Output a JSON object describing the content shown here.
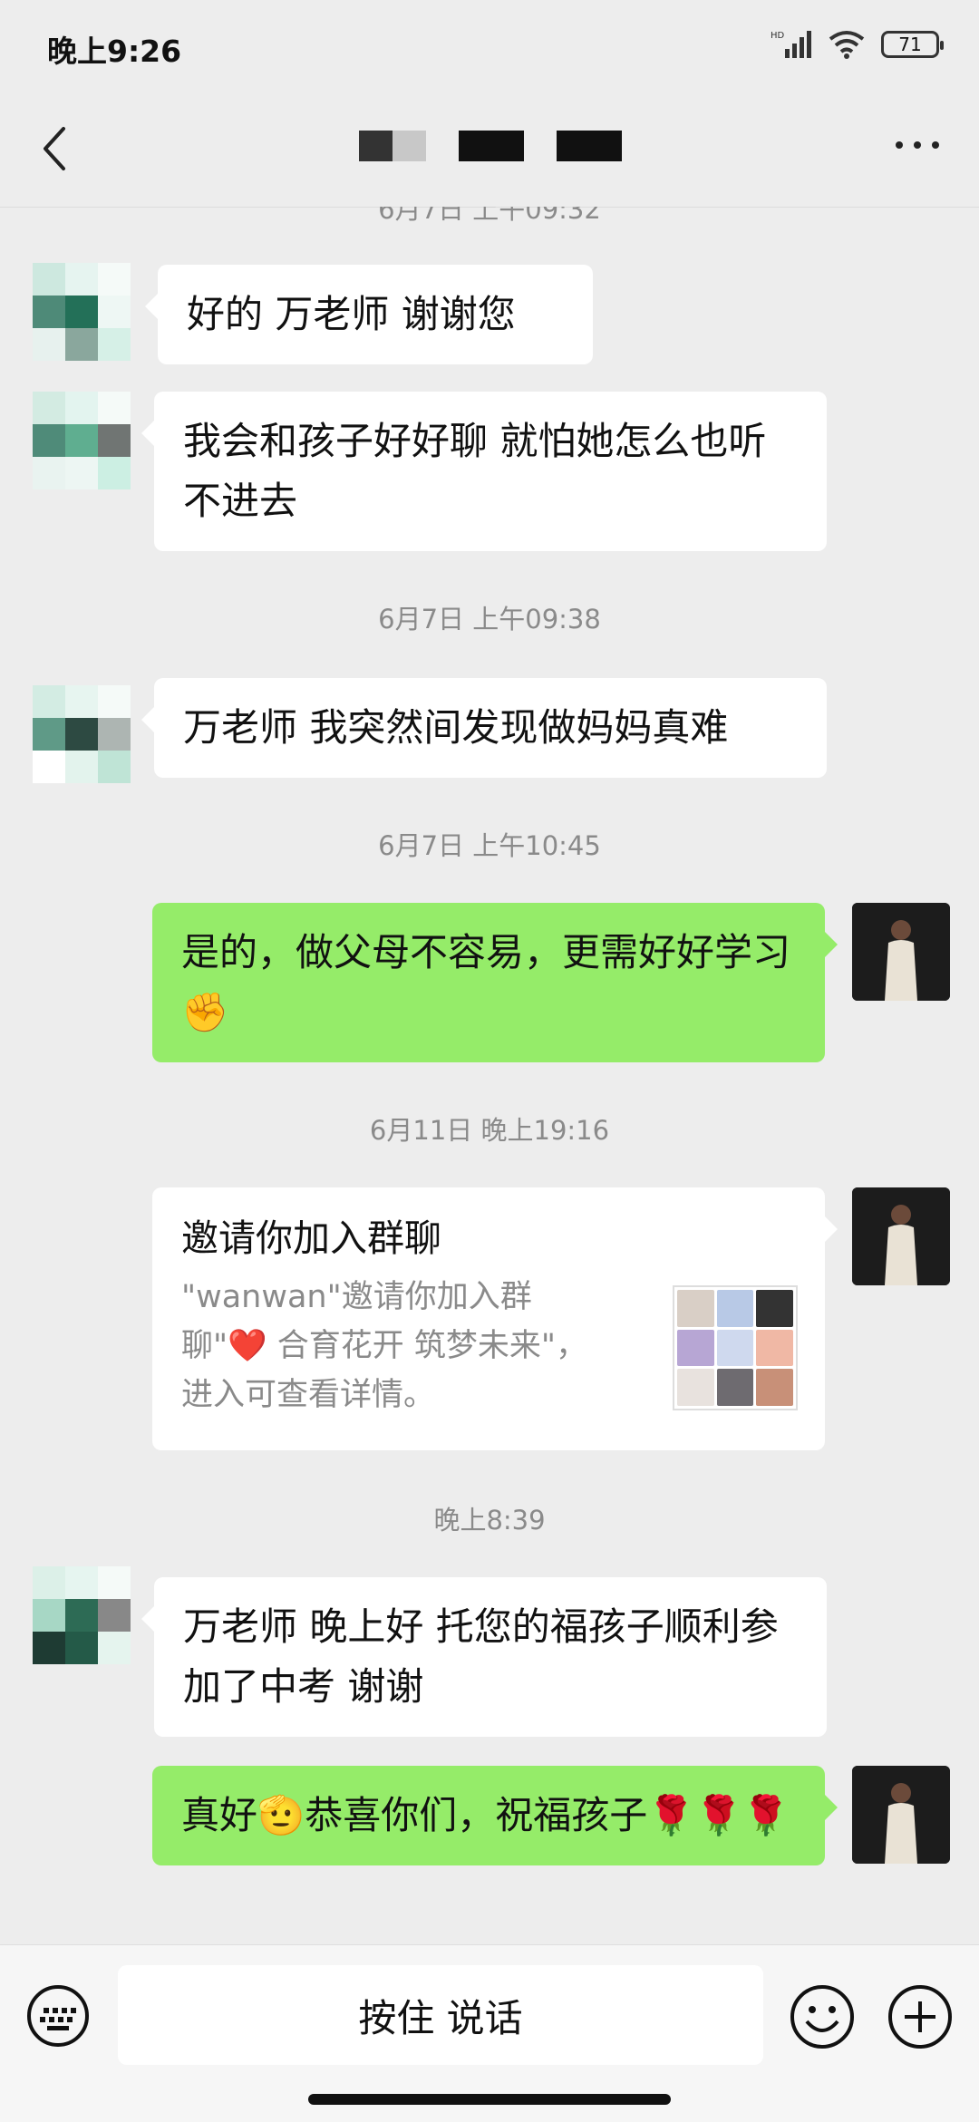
{
  "status_bar": {
    "time": "晚上9:26",
    "hd": "HD",
    "battery": "71"
  },
  "header": {
    "back_icon": "chevron-left-icon",
    "more_icon": "more-dots-icon"
  },
  "messages": {
    "partial_timestamp": "6月7日 上午09:32",
    "m1": "好的  万老师  谢谢您",
    "m2": "我会和孩子好好聊  就怕她怎么也听不进去",
    "ts2": "6月7日 上午09:38",
    "m3": "万老师  我突然间发现做妈妈真难",
    "ts3": "6月7日 上午10:45",
    "m4": "是的，做父母不容易，更需好好学习✊",
    "ts4": "6月11日 晚上19:16",
    "card_title": "邀请你加入群聊",
    "card_desc": "\"wanwan\"邀请你加入群聊\"❤️  合育花开 筑梦未来\"，进入可查看详情。",
    "ts5": "晚上8:39",
    "m5": "万老师   晚上好   托您的福孩子顺利参加了中考   谢谢",
    "m6": "真好🫡恭喜你们，祝福孩子🌹🌹🌹"
  },
  "input": {
    "talk_label": "按住 说话"
  },
  "colors": {
    "sent_bubble": "#95ec69",
    "background": "#ededed"
  }
}
